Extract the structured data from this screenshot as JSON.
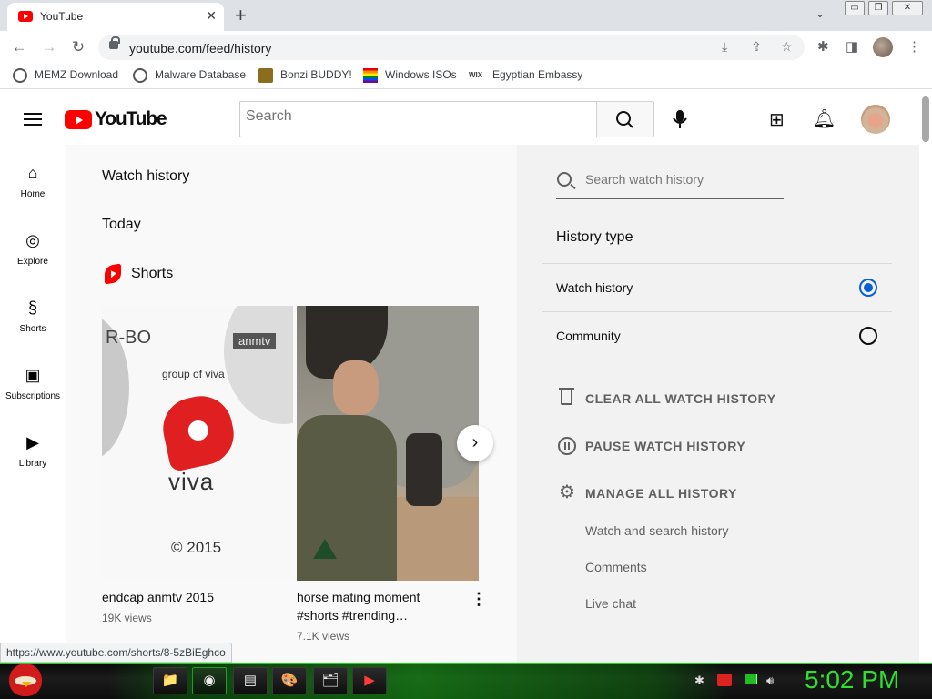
{
  "browser": {
    "tab_title": "YouTube",
    "tab_close": "✕",
    "new_tab": "+",
    "url": "youtube.com/feed/history",
    "window_controls": [
      "▭",
      "❐",
      "✕"
    ],
    "status_url": "https://www.youtube.com/shorts/8-5zBiEghco"
  },
  "bookmarks": [
    {
      "label": "MEMZ Download",
      "icon": "globe-icon",
      "color": "#555555"
    },
    {
      "label": "Malware Database",
      "icon": "globe-icon",
      "color": "#555555"
    },
    {
      "label": "Bonzi BUDDY!",
      "icon": "bonzi-icon",
      "color": "#6b5a1f"
    },
    {
      "label": "Windows ISOs",
      "icon": "rainbow-flag-icon",
      "color": "#e40303"
    },
    {
      "label": "Egyptian Embassy",
      "icon": "wix-icon",
      "color": "#000000"
    }
  ],
  "youtube": {
    "wordmark": "YouTube",
    "search_placeholder": "Search",
    "guide": [
      {
        "label": "Home",
        "icon": "⌂"
      },
      {
        "label": "Explore",
        "icon": "◎"
      },
      {
        "label": "Shorts",
        "icon": "§"
      },
      {
        "label": "Subscriptions",
        "icon": "▣"
      },
      {
        "label": "Library",
        "icon": "▶"
      }
    ],
    "page_title": "Watch history",
    "section_date": "Today",
    "shelf_title": "Shorts",
    "shorts": [
      {
        "title": "endcap anmtv 2015",
        "views": "19K views",
        "thumb_text": {
          "rbo": "R-BO",
          "badge": "anmtv",
          "group": "group of viva",
          "brand": "viva",
          "copyright": "© 2015"
        }
      },
      {
        "title": "horse mating moment #shorts #trending…",
        "views": "7.1K views"
      }
    ],
    "panel": {
      "search_placeholder": "Search watch history",
      "history_type_title": "History type",
      "options": [
        {
          "label": "Watch history",
          "selected": true
        },
        {
          "label": "Community",
          "selected": false
        }
      ],
      "actions": [
        "CLEAR ALL WATCH HISTORY",
        "PAUSE WATCH HISTORY",
        "MANAGE ALL HISTORY"
      ],
      "sublinks": [
        "Watch and search history",
        "Comments",
        "Live chat"
      ]
    }
  },
  "taskbar": {
    "apps": [
      "📁",
      "◉",
      "▤",
      "🎨",
      "🗂",
      "▶"
    ],
    "clock": "5:02 PM"
  },
  "colors": {
    "yt_red": "#ff0000",
    "radio_selected": "#065fd4",
    "taskbar_green": "#2fe02f"
  }
}
